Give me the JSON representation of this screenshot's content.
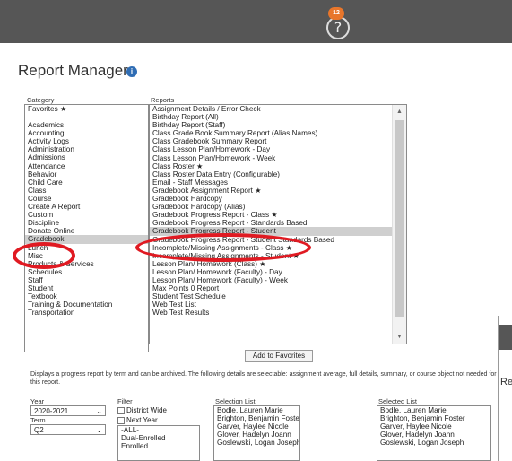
{
  "header": {
    "notification_count": "12",
    "help_icon": "?"
  },
  "page": {
    "title": "Report Manager"
  },
  "category": {
    "label": "Category",
    "items": [
      "Favorites ★",
      "",
      "Academics",
      "Accounting",
      "Activity Logs",
      "Administration",
      "Admissions",
      "Attendance",
      "Behavior",
      "Child Care",
      "Class",
      "Course",
      "Create A Report",
      "Custom",
      "Discipline",
      "Donate Online",
      "Gradebook",
      "Lunch",
      "Misc",
      "Products & Services",
      "Schedules",
      "Staff",
      "Student",
      "Textbook",
      "Training & Documentation",
      "Transportation"
    ],
    "selected_index": 16
  },
  "reports": {
    "label": "Reports",
    "items": [
      "Assignment Details / Error Check",
      "Birthday Report (All)",
      "Birthday Report (Staff)",
      "Class Grade Book Summary Report (Alias Names)",
      "Class Gradebook Summary Report",
      "Class Lesson Plan/Homework - Day",
      "Class Lesson Plan/Homework - Week",
      "Class Roster ★",
      "Class Roster Data Entry (Configurable)",
      "Email - Staff Messages",
      "Gradebook Assignment Report ★",
      "Gradebook Hardcopy",
      "Gradebook Hardcopy (Alias)",
      "Gradebook Progress Report - Class ★",
      "Gradebook Progress Report - Standards Based",
      "Gradebook Progress Report - Student",
      "Gradebook Progress Report - Student Standards Based",
      "Incomplete/Missing Assignments - Class ★",
      "Incomplete/Missing Assignments - Student ★",
      "Lesson Plan/ Homework (Class) ★",
      "Lesson Plan/ Homework (Faculty) - Day",
      "Lesson Plan/ Homework (Faculty) - Week",
      "Max Points 0 Report",
      "Student Test Schedule",
      "Web Test List",
      "Web Test Results"
    ],
    "selected_index": 15
  },
  "add_favorites_label": "Add to Favorites",
  "description": "Displays a progress report by term and can be archived. The following details are selectable: assignment average, full details, summary, or course object not needed for this report.",
  "options": {
    "year_label": "Year",
    "year_value": "2020-2021",
    "term_label": "Term",
    "term_value": "Q2",
    "filter_label": "Filter",
    "district_wide": "District Wide",
    "next_year": "Next Year",
    "filter_items": [
      "-ALL-",
      "Dual-Enrolled",
      "Enrolled"
    ],
    "selection_label": "Selection List",
    "selection_items": [
      "Bodle, Lauren Marie",
      "Brighton, Benjamin Foster",
      "Garver, Haylee Nicole",
      "Glover, Hadelyn Joann",
      "Goslewski, Logan Joseph"
    ],
    "selected_label": "Selected List",
    "selected_items": [
      "Bodle, Lauren Marie",
      "Brighton, Benjamin Foster",
      "Garver, Haylee Nicole",
      "Glover, Hadelyn Joann",
      "Goslewski, Logan Joseph"
    ]
  },
  "overlay": {
    "text": "Re"
  },
  "colors": {
    "header_bg": "#565656",
    "badge": "#e8762b",
    "info_icon": "#2f6db4",
    "highlight": "#e01a22"
  }
}
